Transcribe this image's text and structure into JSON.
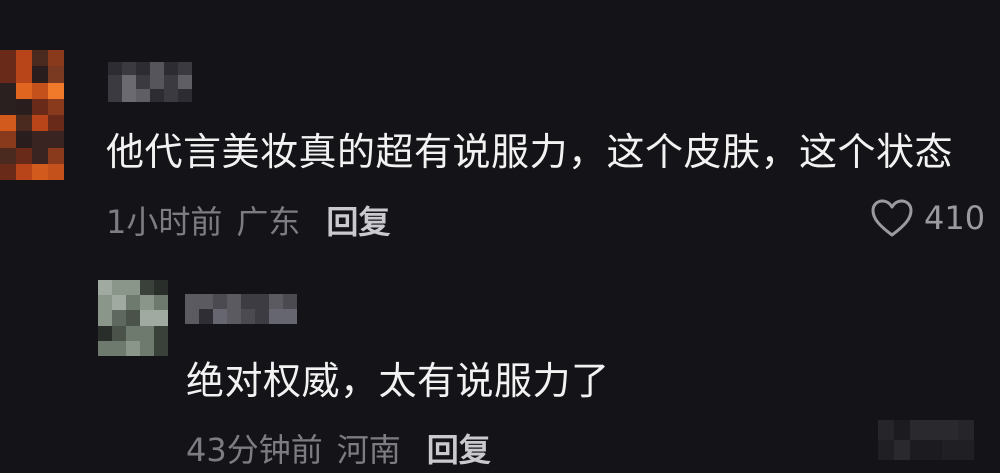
{
  "comment": {
    "text": "他代言美妆真的超有说服力，这个皮肤，这个状态",
    "time": "1小时前",
    "location": "广东",
    "reply_label": "回复",
    "like_count": "410",
    "like_icon": "heart-outline-icon",
    "avatar_blurred": true,
    "username_blurred": true
  },
  "reply": {
    "text": "绝对权威，太有说服力了",
    "time": "43分钟前",
    "location": "河南",
    "reply_label": "回复",
    "avatar_blurred": true,
    "username_blurred": true
  },
  "colors": {
    "background": "#141418",
    "text_primary": "#f2f2f2",
    "text_meta": "#7c7c82",
    "reply_button": "#c9c9ce"
  }
}
